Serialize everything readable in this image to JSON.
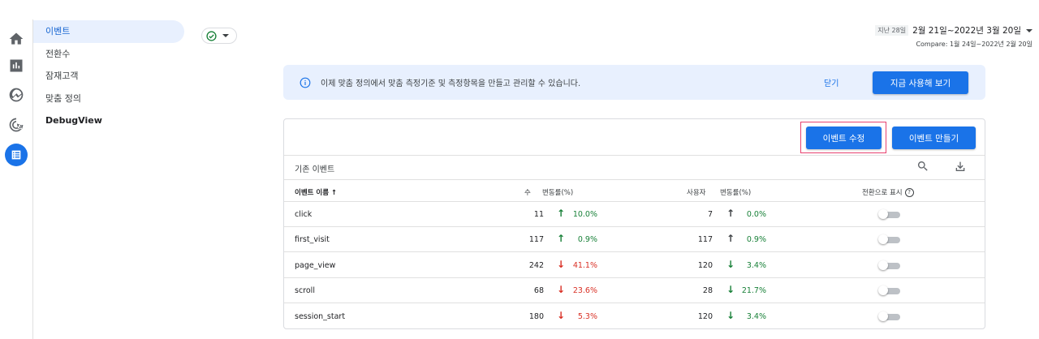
{
  "nav": {
    "items": [
      {
        "label": "이벤트"
      },
      {
        "label": "전환수"
      },
      {
        "label": "잠재고객"
      },
      {
        "label": "맞춤 정의"
      },
      {
        "label": "DebugView"
      }
    ]
  },
  "date": {
    "prefix": "지난 28일",
    "range": "2월 21일~2022년 3월 20일",
    "compare": "Compare: 1월 24일~2022년 2월 20일"
  },
  "banner": {
    "text": "이제 맞춤 정의에서 맞춤 측정기준 및 측정항목을 만들고 관리할 수 있습니다.",
    "close": "닫기",
    "cta": "지금 사용해 보기"
  },
  "card": {
    "edit_button": "이벤트 수정",
    "create_button": "이벤트 만들기",
    "section_title": "기존 이벤트",
    "headers": {
      "name": "이벤트 이름 ↑",
      "count": "수",
      "count_change": "변동률(%)",
      "users": "사용자",
      "users_change": "변동률(%)",
      "conversion": "전환으로 표시",
      "help": "?"
    },
    "rows": [
      {
        "name": "click",
        "count": "11",
        "count_arrow": "↑",
        "count_change": "10.0%",
        "users": "7",
        "users_arrow": "↑",
        "users_change": "0.0%"
      },
      {
        "name": "first_visit",
        "count": "117",
        "count_arrow": "↑",
        "count_change": "0.9%",
        "users": "117",
        "users_arrow": "↑",
        "users_change": "0.9%"
      },
      {
        "name": "page_view",
        "count": "242",
        "count_arrow": "↓",
        "count_change": "41.1%",
        "users": "120",
        "users_arrow": "↓",
        "users_change": "3.4%"
      },
      {
        "name": "scroll",
        "count": "68",
        "count_arrow": "↓",
        "count_change": "23.6%",
        "users": "28",
        "users_arrow": "↓",
        "users_change": "21.7%"
      },
      {
        "name": "session_start",
        "count": "180",
        "count_arrow": "↓",
        "count_change": "5.3%",
        "users": "120",
        "users_arrow": "↓",
        "users_change": "3.4%"
      }
    ]
  },
  "colors": {
    "accent": "#1a73e8",
    "positive": "#188038",
    "negative": "#d93025",
    "highlight": "#e8426f"
  }
}
